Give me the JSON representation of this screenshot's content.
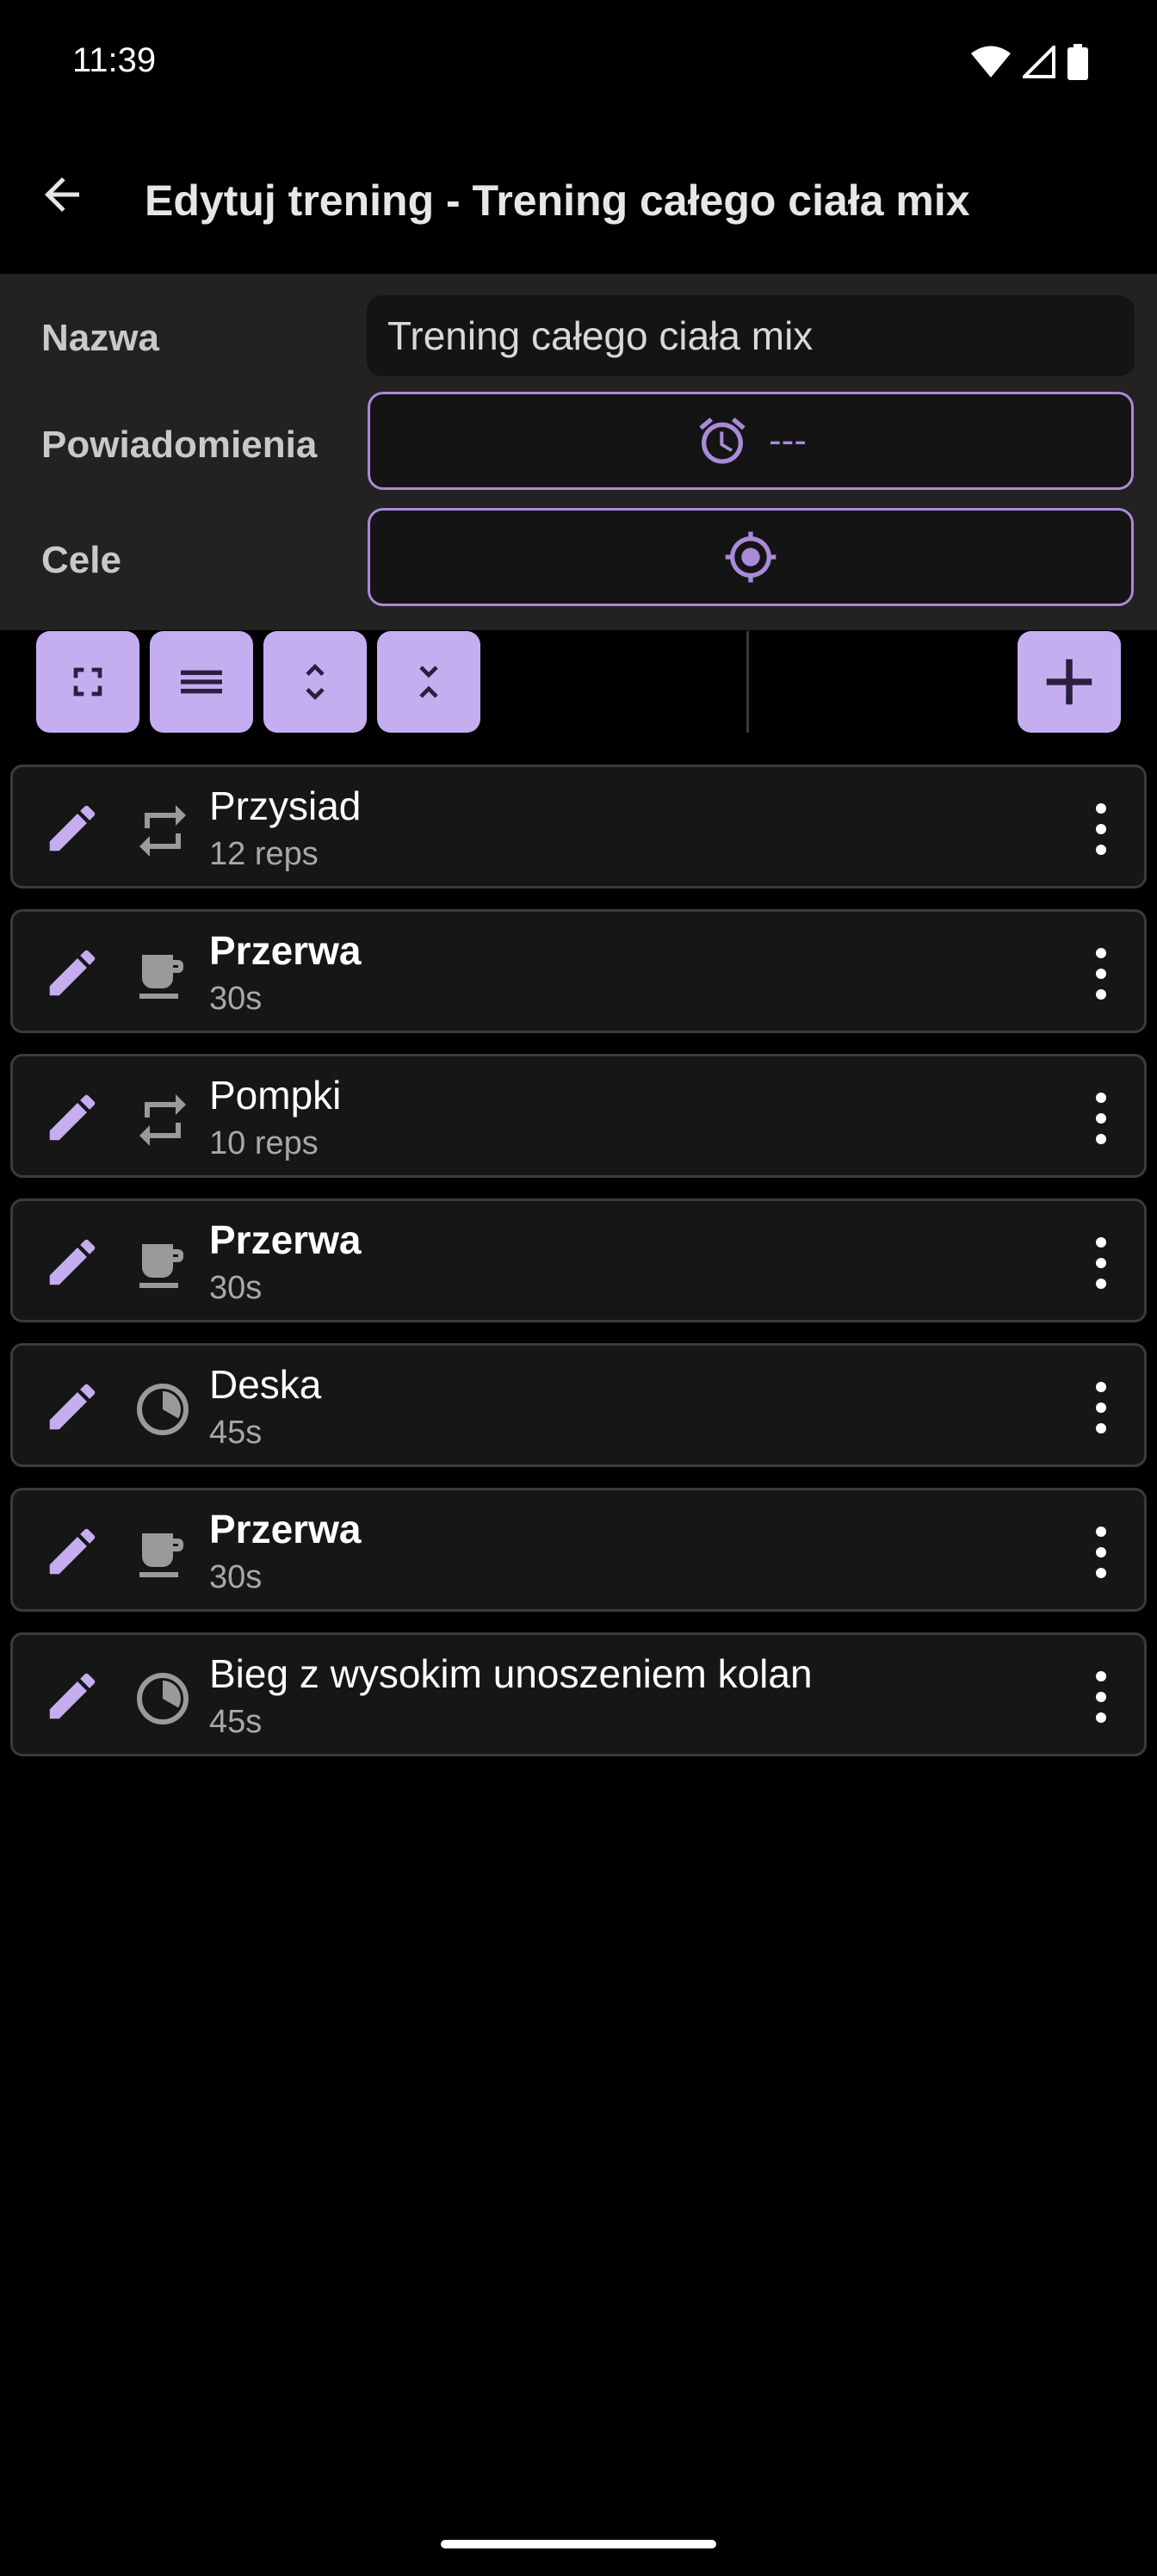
{
  "status_bar": {
    "time": "11:39"
  },
  "app_bar": {
    "title": "Edytuj trening - Trening całego ciała mix"
  },
  "form": {
    "name_label": "Nazwa",
    "name_value": "Trening całego ciała mix",
    "notifications_label": "Powiadomienia",
    "notifications_value": "---",
    "goals_label": "Cele"
  },
  "items": [
    {
      "title": "Przysiad",
      "subtitle": "12 reps",
      "icon": "repeat-icon"
    },
    {
      "title": "Przerwa",
      "subtitle": "30s",
      "icon": "cup-icon"
    },
    {
      "title": "Pompki",
      "subtitle": "10 reps",
      "icon": "repeat-icon"
    },
    {
      "title": "Przerwa",
      "subtitle": "30s",
      "icon": "cup-icon"
    },
    {
      "title": "Deska",
      "subtitle": "45s",
      "icon": "timer-icon"
    },
    {
      "title": "Przerwa",
      "subtitle": "30s",
      "icon": "cup-icon"
    },
    {
      "title": "Bieg z wysokim unoszeniem kolan",
      "subtitle": "45s",
      "icon": "timer-icon"
    }
  ],
  "colors": {
    "accent": "#c4aef0",
    "outline": "#a98ad9",
    "panel": "#222222",
    "background": "#000000"
  }
}
